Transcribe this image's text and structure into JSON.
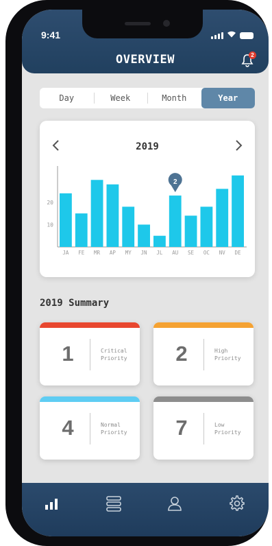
{
  "status_bar": {
    "time": "9:41"
  },
  "header": {
    "title": "OVERVIEW",
    "notification_count": "2"
  },
  "period_tabs": [
    {
      "label": "Day",
      "active": false
    },
    {
      "label": "Week",
      "active": false
    },
    {
      "label": "Month",
      "active": false
    },
    {
      "label": "Year",
      "active": true
    }
  ],
  "chart_card": {
    "year": "2019",
    "prev_icon": "chevron-left-icon",
    "next_icon": "chevron-right-icon"
  },
  "chart_data": {
    "type": "bar",
    "categories": [
      "JA",
      "FE",
      "MR",
      "AP",
      "MY",
      "JN",
      "JL",
      "AU",
      "SE",
      "OC",
      "NV",
      "DE"
    ],
    "values": [
      24,
      15,
      30,
      28,
      18,
      10,
      5,
      23,
      14,
      18,
      26,
      32
    ],
    "ylim": [
      0,
      35
    ],
    "yticks": [
      10,
      20
    ],
    "bar_color": "#1ec8ea",
    "marker": {
      "category": "AU",
      "label": "2",
      "color": "#4e7393"
    }
  },
  "summary": {
    "title": "2019 Summary",
    "cards": [
      {
        "count": "1",
        "line1": "Critical",
        "line2": "Priority",
        "color": "#e8472f"
      },
      {
        "count": "2",
        "line1": "High",
        "line2": "Priority",
        "color": "#f5a232"
      },
      {
        "count": "4",
        "line1": "Normal",
        "line2": "Priority",
        "color": "#5fcdf3"
      },
      {
        "count": "7",
        "line1": "Low",
        "line2": "Priority",
        "color": "#8d8d8d"
      }
    ]
  },
  "tab_bar": {
    "items": [
      {
        "icon": "bar-chart-icon",
        "active": true
      },
      {
        "icon": "list-icon",
        "active": false
      },
      {
        "icon": "user-icon",
        "active": false
      },
      {
        "icon": "gear-icon",
        "active": false
      }
    ]
  },
  "colors": {
    "header": "#2a4a6b",
    "accent": "#5f87a8",
    "bar": "#1ec8ea"
  }
}
